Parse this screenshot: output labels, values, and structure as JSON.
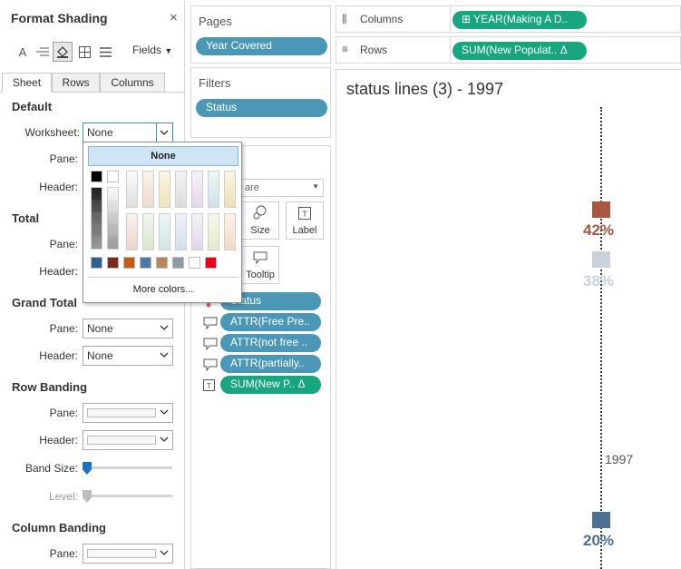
{
  "format_panel": {
    "title": "Format Shading",
    "close": "×",
    "fields_label": "Fields",
    "tabs": [
      "Sheet",
      "Rows",
      "Columns"
    ],
    "sections": {
      "default": "Default",
      "total": "Total",
      "grand_total": "Grand Total",
      "row_banding": "Row Banding",
      "column_banding": "Column Banding"
    },
    "labels": {
      "worksheet": "Worksheet:",
      "pane": "Pane:",
      "header": "Header:",
      "band_size": "Band Size:",
      "level": "Level:"
    },
    "worksheet_value": "None",
    "grand_total_pane_value": "None",
    "grand_total_header_value": "None",
    "band_size_level": 0.0,
    "level_level": 0.0
  },
  "color_popup": {
    "none_label": "None",
    "more_colors": "More colors...",
    "palette_row1": [
      "#000000",
      "#ffffff"
    ],
    "bottom_swatches": [
      "#2e5f8f",
      "#7a2a1e",
      "#c55a11",
      "#4e79a7",
      "#b8865a",
      "#8e9aa7",
      "#ffffff",
      "#e8001c"
    ]
  },
  "pages": {
    "title": "Pages",
    "pill": "Year Covered"
  },
  "filters": {
    "title": "Filters",
    "pill": "Status"
  },
  "marks": {
    "mark_type": "are",
    "buttons": {
      "size": "Size",
      "label": "Label",
      "tooltip": "Tooltip"
    },
    "pills": [
      "Status",
      "ATTR(Free Pre..",
      "ATTR(not free ..",
      "ATTR(partially..",
      "SUM(New P..  Δ"
    ]
  },
  "shelves": {
    "columns_label": "Columns",
    "columns_pill": "⊞ YEAR(Making A D..",
    "rows_label": "Rows",
    "rows_pill": "SUM(New Populat..  Δ"
  },
  "viz": {
    "title": "status lines (3) - 1997",
    "year_label": "1997",
    "points": [
      {
        "label": "42%",
        "color": "#a9573f"
      },
      {
        "label": "38%",
        "color": "#c8d1dc"
      },
      {
        "label": "20%",
        "color": "#4d6f91"
      }
    ]
  },
  "colors": {
    "accent_blue": "#4a97b7",
    "accent_green": "#17a67d",
    "selection": "#cfe4f7"
  }
}
